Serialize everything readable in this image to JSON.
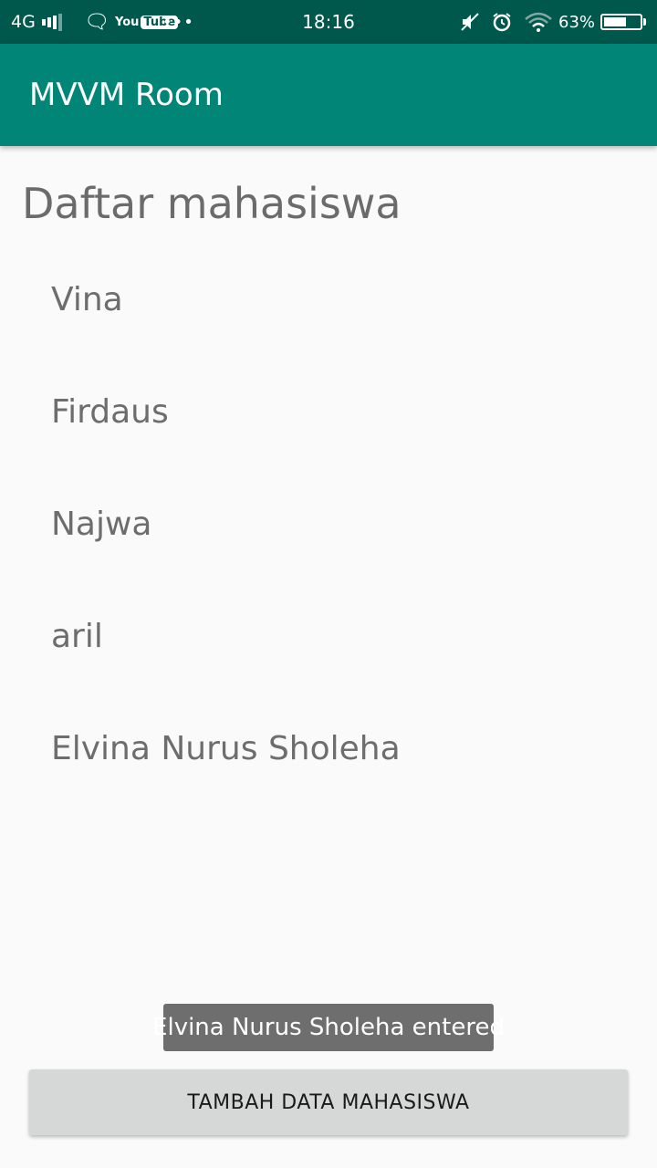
{
  "status_bar": {
    "network": "4G",
    "youtube_you": "You",
    "youtube_tube": "Tube",
    "more": "•••",
    "time": "18:16",
    "battery_percent": "63%",
    "battery_level": 0.63,
    "icons": [
      "signal-icon",
      "chat-bubble-icon",
      "youtube-icon",
      "more-dots-icon",
      "mute-icon",
      "alarm-icon",
      "wifi-icon",
      "battery-icon"
    ]
  },
  "app_bar": {
    "title": "MVVM Room",
    "color": "#008577",
    "status_color": "#00574b"
  },
  "main": {
    "heading": "Daftar mahasiswa",
    "students": [
      {
        "name": "Vina"
      },
      {
        "name": "Firdaus"
      },
      {
        "name": "Najwa"
      },
      {
        "name": "aril"
      },
      {
        "name": "Elvina Nurus Sholeha"
      }
    ]
  },
  "toast": {
    "message": "Elvina Nurus Sholeha entered"
  },
  "button": {
    "label": "TAMBAH DATA MAHASISWA"
  }
}
